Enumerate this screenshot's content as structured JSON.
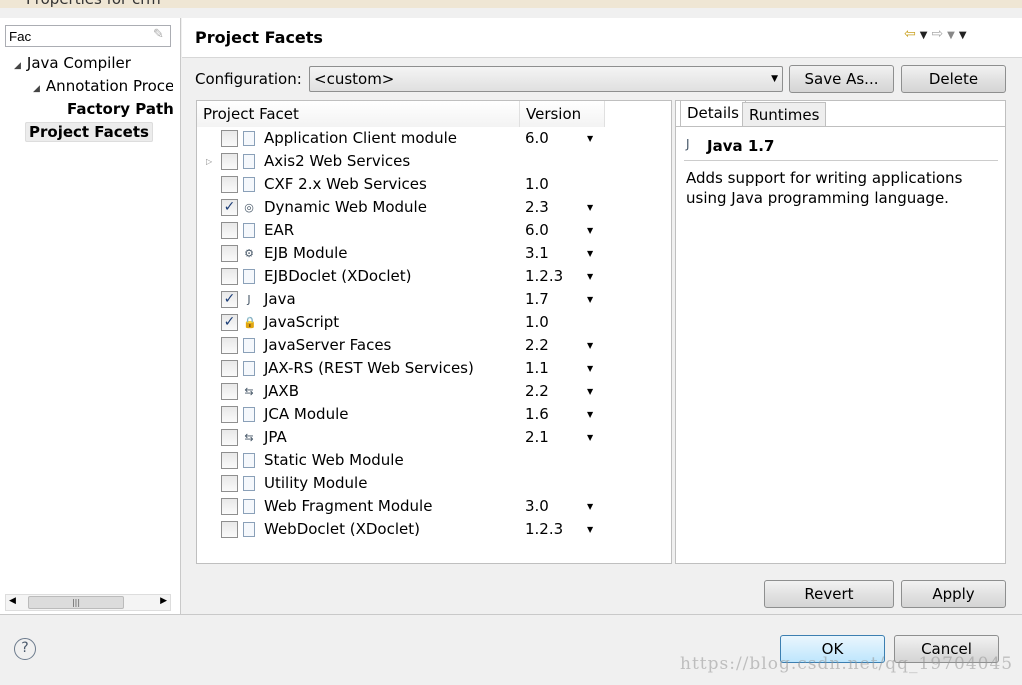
{
  "window": {
    "title": "Properties for crm"
  },
  "sidebar": {
    "filter_value": "Fac",
    "items": [
      {
        "label": "Java Compiler",
        "expanded": true
      },
      {
        "label": "Annotation Proce",
        "expanded": true
      },
      {
        "label": "Factory Path"
      },
      {
        "label": "Project Facets",
        "selected": true
      }
    ]
  },
  "header": {
    "title": "Project Facets"
  },
  "config": {
    "label": "Configuration:",
    "value": "<custom>",
    "save_as": "Save As...",
    "delete": "Delete"
  },
  "table": {
    "col_facet": "Project Facet",
    "col_version": "Version",
    "rows": [
      {
        "name": "Application Client module",
        "version": "6.0",
        "checked": false,
        "icon": "page",
        "dd": true
      },
      {
        "name": "Axis2 Web Services",
        "version": "",
        "checked": false,
        "icon": "page",
        "expandable": true
      },
      {
        "name": "CXF 2.x Web Services",
        "version": "1.0",
        "checked": false,
        "icon": "page"
      },
      {
        "name": "Dynamic Web Module",
        "version": "2.3",
        "checked": true,
        "icon": "globe",
        "dd": true
      },
      {
        "name": "EAR",
        "version": "6.0",
        "checked": false,
        "icon": "page",
        "dd": true
      },
      {
        "name": "EJB Module",
        "version": "3.1",
        "checked": false,
        "icon": "bean",
        "dd": true
      },
      {
        "name": "EJBDoclet (XDoclet)",
        "version": "1.2.3",
        "checked": false,
        "icon": "page",
        "dd": true
      },
      {
        "name": "Java",
        "version": "1.7",
        "checked": true,
        "icon": "java",
        "dd": true
      },
      {
        "name": "JavaScript",
        "version": "1.0",
        "checked": true,
        "icon": "lock"
      },
      {
        "name": "JavaServer Faces",
        "version": "2.2",
        "checked": false,
        "icon": "page",
        "dd": true
      },
      {
        "name": "JAX-RS (REST Web Services)",
        "version": "1.1",
        "checked": false,
        "icon": "page",
        "dd": true
      },
      {
        "name": "JAXB",
        "version": "2.2",
        "checked": false,
        "icon": "arrows",
        "dd": true
      },
      {
        "name": "JCA Module",
        "version": "1.6",
        "checked": false,
        "icon": "page",
        "dd": true
      },
      {
        "name": "JPA",
        "version": "2.1",
        "checked": false,
        "icon": "arrows",
        "dd": true
      },
      {
        "name": "Static Web Module",
        "version": "",
        "checked": false,
        "icon": "page"
      },
      {
        "name": "Utility Module",
        "version": "",
        "checked": false,
        "icon": "page"
      },
      {
        "name": "Web Fragment Module",
        "version": "3.0",
        "checked": false,
        "icon": "page",
        "dd": true
      },
      {
        "name": "WebDoclet (XDoclet)",
        "version": "1.2.3",
        "checked": false,
        "icon": "page",
        "dd": true
      }
    ]
  },
  "details": {
    "tabs": [
      "Details",
      "Runtimes"
    ],
    "title": "Java 1.7",
    "desc1": "Adds support for writing applications",
    "desc2": "using Java programming language."
  },
  "buttons": {
    "revert": "Revert",
    "apply": "Apply",
    "ok": "OK",
    "cancel": "Cancel"
  },
  "watermark": "https://blog.csdn.net/qq_19704045"
}
